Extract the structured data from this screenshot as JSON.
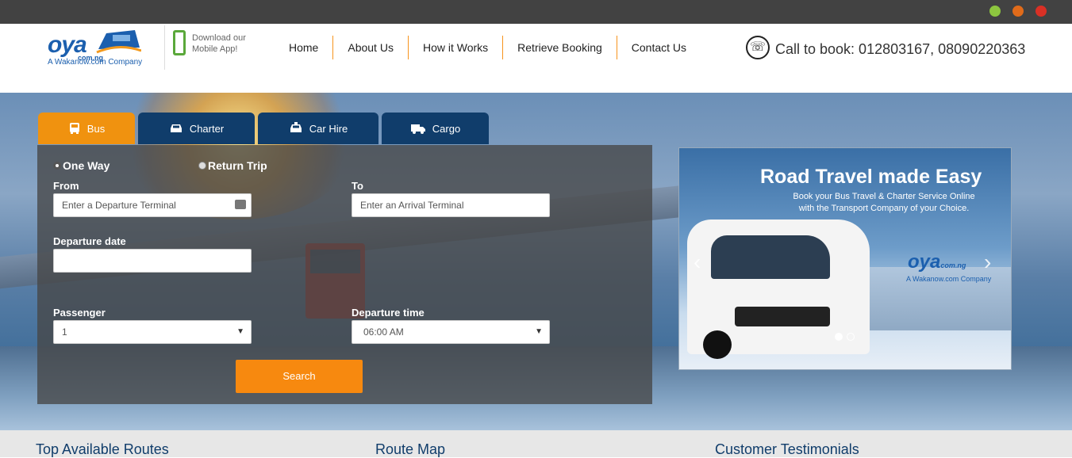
{
  "window": {
    "dots": [
      {
        "name": "green",
        "color": "#8dc63f"
      },
      {
        "name": "orange",
        "color": "#e06b1a"
      },
      {
        "name": "red",
        "color": "#d93025"
      }
    ]
  },
  "header": {
    "logo_text": "oya",
    "logo_sub": "com.ng",
    "logo_tagline": "A Wakanow.com Company",
    "app_line1": "Download our",
    "app_line2": "Mobile App!",
    "nav": [
      "Home",
      "About Us",
      "How it Works",
      "Retrieve Booking",
      "Contact Us"
    ],
    "call_text": "Call to book: 012803167, 08090220363"
  },
  "tabs": [
    {
      "label": "Bus",
      "icon": "bus-icon",
      "active": true
    },
    {
      "label": "Charter",
      "icon": "car-icon",
      "active": false
    },
    {
      "label": "Car Hire",
      "icon": "taxi-icon",
      "active": false
    },
    {
      "label": "Cargo",
      "icon": "truck-icon",
      "active": false
    }
  ],
  "form": {
    "trip_one_way": "One Way",
    "trip_return": "Return Trip",
    "from_label": "From",
    "from_placeholder": "Enter a Departure Terminal",
    "to_label": "To",
    "to_placeholder": "Enter an Arrival Terminal",
    "date_label": "Departure date",
    "date_value": "",
    "passenger_label": "Passenger",
    "passenger_value": "1",
    "time_label": "Departure time",
    "time_value": "06:00 AM",
    "search_label": "Search"
  },
  "promo": {
    "title": "Road Travel made Easy",
    "sub1": "Book your Bus Travel & Charter Service  Online",
    "sub2": "with the Transport Company of your Choice.",
    "logo_text": "oya",
    "logo_sub": "com.ng",
    "logo_tagline": "A Wakanow.com Company"
  },
  "sections": [
    "Top Available Routes",
    "Route Map",
    "Customer Testimonials"
  ],
  "colors": {
    "accent": "#f7890f",
    "brand": "#1b5fae",
    "navy": "#103d6b"
  }
}
